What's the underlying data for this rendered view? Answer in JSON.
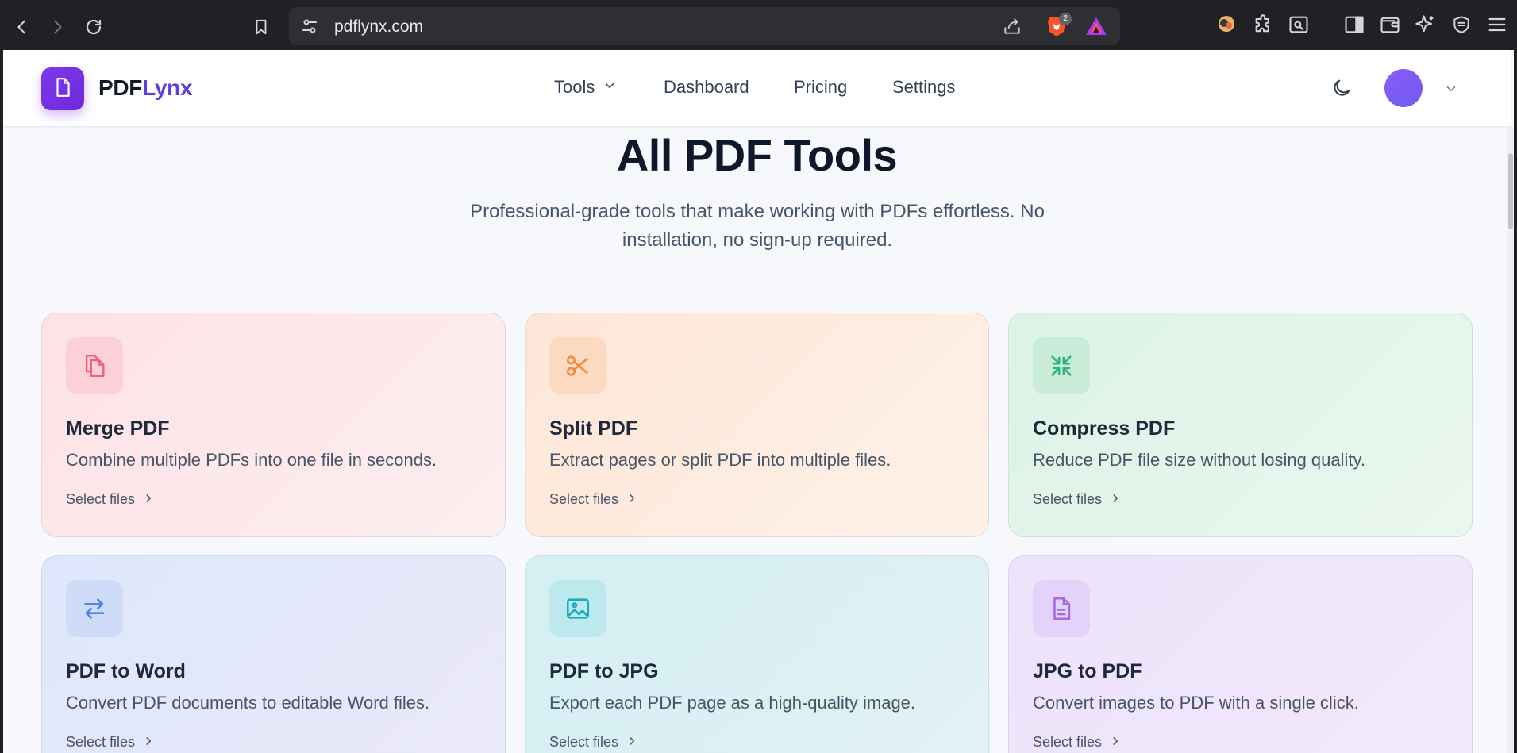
{
  "browser": {
    "url": "pdflynx.com",
    "shields_count": "2"
  },
  "header": {
    "brand_part1": "PDF",
    "brand_part2": "Lynx",
    "nav": {
      "tools": "Tools",
      "dashboard": "Dashboard",
      "pricing": "Pricing",
      "settings": "Settings"
    }
  },
  "hero": {
    "title": "All PDF Tools",
    "subtitle": "Professional-grade tools that make working with PDFs effortless. No installation, no sign-up required."
  },
  "cards": [
    {
      "title": "Merge PDF",
      "desc": "Combine multiple PDFs into one file in seconds.",
      "link": "Select files",
      "icon": "merge-icon",
      "accent": "#f0607a"
    },
    {
      "title": "Split PDF",
      "desc": "Extract pages or split PDF into multiple files.",
      "link": "Select files",
      "icon": "scissors-icon",
      "accent": "#f08a3c"
    },
    {
      "title": "Compress PDF",
      "desc": "Reduce PDF file size without losing quality.",
      "link": "Select files",
      "icon": "compress-icon",
      "accent": "#2fb37a"
    },
    {
      "title": "PDF to Word",
      "desc": "Convert PDF documents to editable Word files.",
      "link": "Select files",
      "icon": "convert-arrows-icon",
      "accent": "#4a86e8"
    },
    {
      "title": "PDF to JPG",
      "desc": "Export each PDF page as a high-quality image.",
      "link": "Select files",
      "icon": "image-icon",
      "accent": "#18aebd"
    },
    {
      "title": "JPG to PDF",
      "desc": "Convert images to PDF with a single click.",
      "link": "Select files",
      "icon": "document-icon",
      "accent": "#a66be0"
    }
  ],
  "colors": {
    "brand": "#6d28d9",
    "brand_text": "#5b3fe0"
  }
}
